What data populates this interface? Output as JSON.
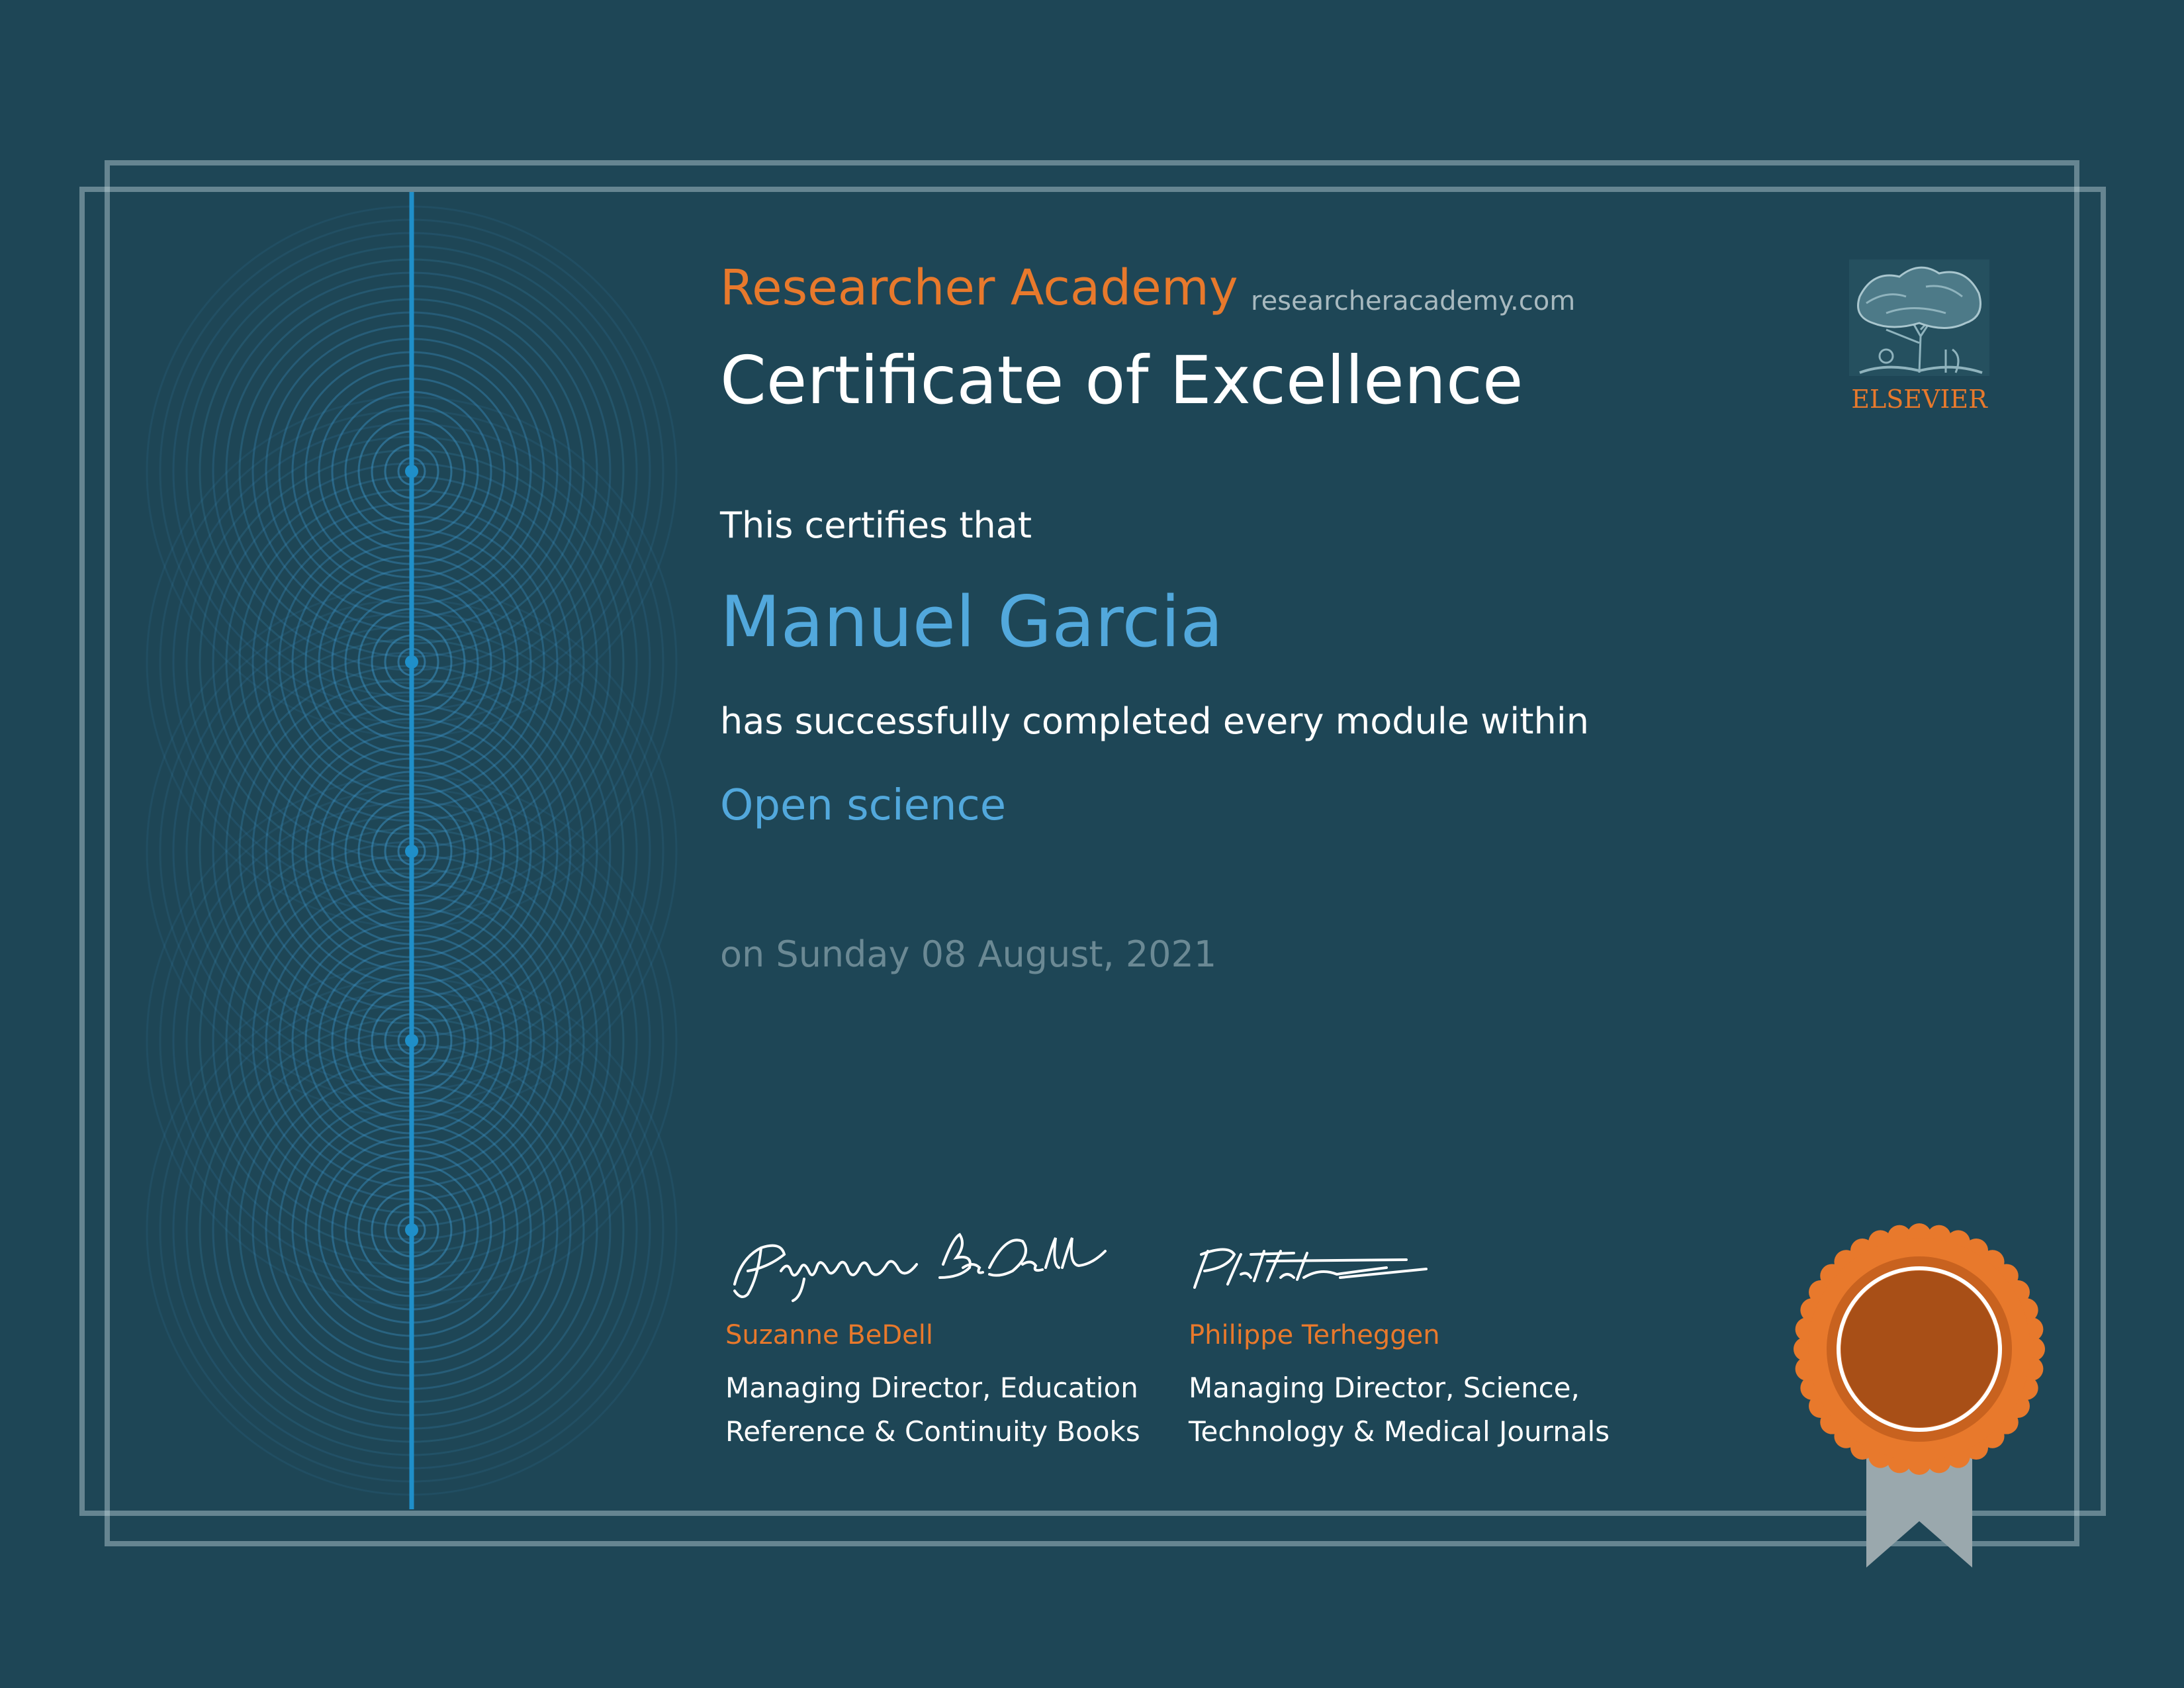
{
  "brand": {
    "name": "Researcher Academy",
    "website": "researcheracademy.com"
  },
  "certificate": {
    "title": "Certificate of Excellence",
    "intro": "This certifies that",
    "recipient": "Manuel Garcia",
    "completion_text": "has successfully completed every module within",
    "course": "Open science",
    "date_text": "on Sunday 08 August, 2021"
  },
  "publisher": {
    "logo_wordmark": "ELSEVIER",
    "logo_icon": "tree-icon"
  },
  "signatories": [
    {
      "name": "Suzanne BeDell",
      "role_line1": "Managing Director, Education",
      "role_line2": "Reference & Continuity Books"
    },
    {
      "name": "Philippe Terheggen",
      "role_line1": "Managing Director, Science,",
      "role_line2": "Technology & Medical Journals"
    }
  ],
  "colors": {
    "background": "#1e4656",
    "accent_orange": "#e8792c",
    "accent_blue": "#52a8dc",
    "muted_text": "#6b8994",
    "seal_inner": "#a84f17"
  }
}
